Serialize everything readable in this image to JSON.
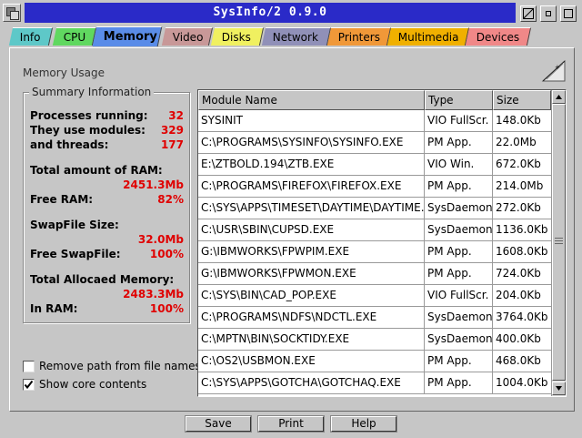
{
  "window": {
    "title": "SysInfo/2 0.9.0"
  },
  "tabs": [
    {
      "label": "Info",
      "color": "#5ec8c8",
      "active": false
    },
    {
      "label": "CPU",
      "color": "#60d860",
      "active": false
    },
    {
      "label": "Memory",
      "color": "#5a8ce8",
      "active": true
    },
    {
      "label": "Video",
      "color": "#c89898",
      "active": false
    },
    {
      "label": "Disks",
      "color": "#f0f060",
      "active": false
    },
    {
      "label": "Network",
      "color": "#9090b8",
      "active": false
    },
    {
      "label": "Printers",
      "color": "#f09838",
      "active": false
    },
    {
      "label": "Multimedia",
      "color": "#f0b000",
      "active": false
    },
    {
      "label": "Devices",
      "color": "#f08888",
      "active": false
    }
  ],
  "panel": {
    "title": "Memory Usage"
  },
  "summary": {
    "title": "Summary Information",
    "processes_label": "Processes running:",
    "processes_value": "32",
    "modules_label": "They use modules:",
    "modules_value": "329",
    "threads_label": "and threads:",
    "threads_value": "177",
    "total_ram_label": "Total amount of RAM:",
    "total_ram_value": "2451.3Mb",
    "free_ram_label": "Free RAM:",
    "free_ram_value": "82%",
    "swap_size_label": "SwapFile Size:",
    "swap_size_value": "32.0Mb",
    "free_swap_label": "Free SwapFile:",
    "free_swap_value": "100%",
    "allocated_label": "Total Allocaed Memory:",
    "allocated_value": "2483.3Mb",
    "in_ram_label": "In RAM:",
    "in_ram_value": "100%"
  },
  "options": {
    "remove_path_label": "Remove path from file names",
    "remove_path_checked": false,
    "show_core_label": "Show core contents",
    "show_core_checked": true
  },
  "table": {
    "headers": [
      "Module Name",
      "Type",
      "Size"
    ],
    "rows": [
      [
        "SYSINIT",
        "VIO FullScr.",
        "148.0Kb"
      ],
      [
        "C:\\PROGRAMS\\SYSINFO\\SYSINFO.EXE",
        "PM App.",
        "22.0Mb"
      ],
      [
        "E:\\ZTBOLD.194\\ZTB.EXE",
        "VIO Win.",
        "672.0Kb"
      ],
      [
        "C:\\PROGRAMS\\FIREFOX\\FIREFOX.EXE",
        "PM App.",
        "214.0Mb"
      ],
      [
        "C:\\SYS\\APPS\\TIMESET\\DAYTIME\\DAYTIME.EXE",
        "SysDaemon",
        "272.0Kb"
      ],
      [
        "C:\\USR\\SBIN\\CUPSD.EXE",
        "SysDaemon",
        "1136.0Kb"
      ],
      [
        "G:\\IBMWORKS\\FPWPIM.EXE",
        "PM App.",
        "1608.0Kb"
      ],
      [
        "G:\\IBMWORKS\\FPWMON.EXE",
        "PM App.",
        "724.0Kb"
      ],
      [
        "C:\\SYS\\BIN\\CAD_POP.EXE",
        "VIO FullScr.",
        "204.0Kb"
      ],
      [
        "C:\\PROGRAMS\\NDFS\\NDCTL.EXE",
        "SysDaemon",
        "3764.0Kb"
      ],
      [
        "C:\\MPTN\\BIN\\SOCKTIDY.EXE",
        "SysDaemon",
        "400.0Kb"
      ],
      [
        "C:\\OS2\\USBMON.EXE",
        "PM App.",
        "468.0Kb"
      ],
      [
        "C:\\SYS\\APPS\\GOTCHA\\GOTCHAQ.EXE",
        "PM App.",
        "1004.0Kb"
      ]
    ]
  },
  "buttons": {
    "save": "Save",
    "print": "Print",
    "help": "Help"
  }
}
